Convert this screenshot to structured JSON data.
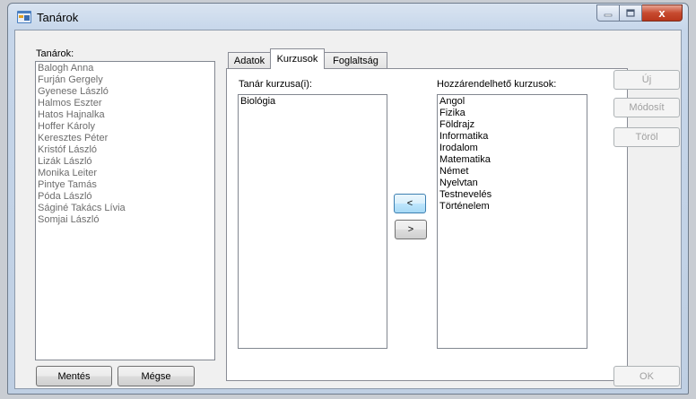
{
  "window": {
    "title": "Tanárok",
    "close_glyph": "x"
  },
  "left": {
    "label": "Tanárok:",
    "teachers": [
      "Balogh Anna",
      "Furján Gergely",
      "Gyenese László",
      "Halmos Eszter",
      "Hatos Hajnalka",
      "Hoffer Károly",
      "Keresztes Péter",
      "Kristóf László",
      "Lizák László",
      "Monika Leiter",
      "Pintye Tamás",
      "Póda László",
      "Ságiné Takács Lívia",
      "Somjai László"
    ],
    "save_label": "Mentés",
    "cancel_label": "Mégse"
  },
  "tabs": [
    "Adatok",
    "Kurzusok",
    "Foglaltság"
  ],
  "active_tab": "Kurzusok",
  "courses": {
    "teacher_courses_label": "Tanár kurzusa(i):",
    "teacher_courses": [
      "Biológia"
    ],
    "available_label": "Hozzárendelhető kurzusok:",
    "available_courses": [
      "Angol",
      "Fizika",
      "Földrajz",
      "Informatika",
      "Irodalom",
      "Matematika",
      "Német",
      "Nyelvtan",
      "Testnevelés",
      "Történelem"
    ],
    "add_arrow": "<",
    "remove_arrow": ">"
  },
  "right": {
    "new_label": "Új",
    "modify_label": "Módosít",
    "delete_label": "Töröl",
    "ok_label": "OK"
  },
  "colors": {
    "disabled_text": "#a0a0a0",
    "list_text_disabled": "#6d6d6d",
    "close_red": "#c74a2f"
  },
  "icons": {
    "app": "application-icon",
    "minimize": "minimize-icon",
    "maximize": "maximize-icon",
    "close": "close-icon"
  }
}
